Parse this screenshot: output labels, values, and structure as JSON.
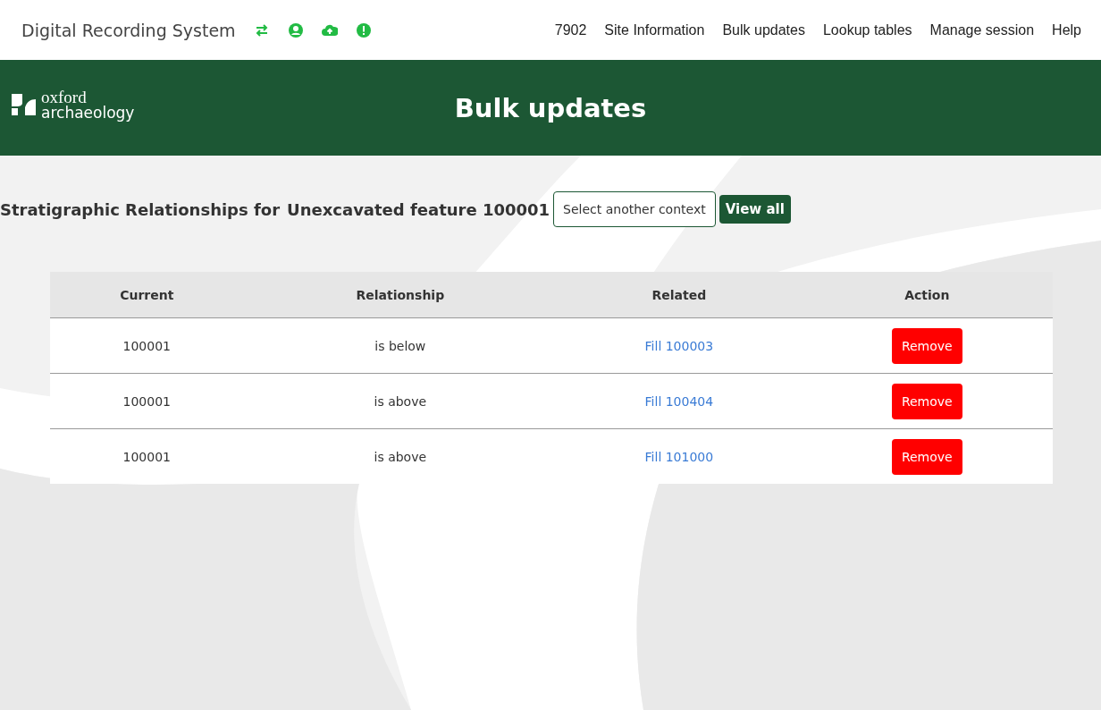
{
  "nav": {
    "title": "Digital Recording System",
    "links": [
      {
        "label": "7902"
      },
      {
        "label": "Site Information"
      },
      {
        "label": "Bulk updates"
      },
      {
        "label": "Lookup tables"
      },
      {
        "label": "Manage session"
      },
      {
        "label": "Help"
      }
    ]
  },
  "banner": {
    "logo_top": "oxford",
    "logo_bottom": "archaeology",
    "title": "Bulk updates"
  },
  "heading": {
    "prefix": "Stratigraphic Relationships for",
    "context": "Unexcavated feature 100001",
    "select_button": "Select another context",
    "view_all_button": "View all"
  },
  "table": {
    "columns": [
      "Current",
      "Relationship",
      "Related",
      "Action"
    ],
    "rows": [
      {
        "current": "100001",
        "relationship": "is below",
        "related": "Fill 100003",
        "action": "Remove"
      },
      {
        "current": "100001",
        "relationship": "is above",
        "related": "Fill 100404",
        "action": "Remove"
      },
      {
        "current": "100001",
        "relationship": "is above",
        "related": "Fill 101000",
        "action": "Remove"
      }
    ]
  }
}
